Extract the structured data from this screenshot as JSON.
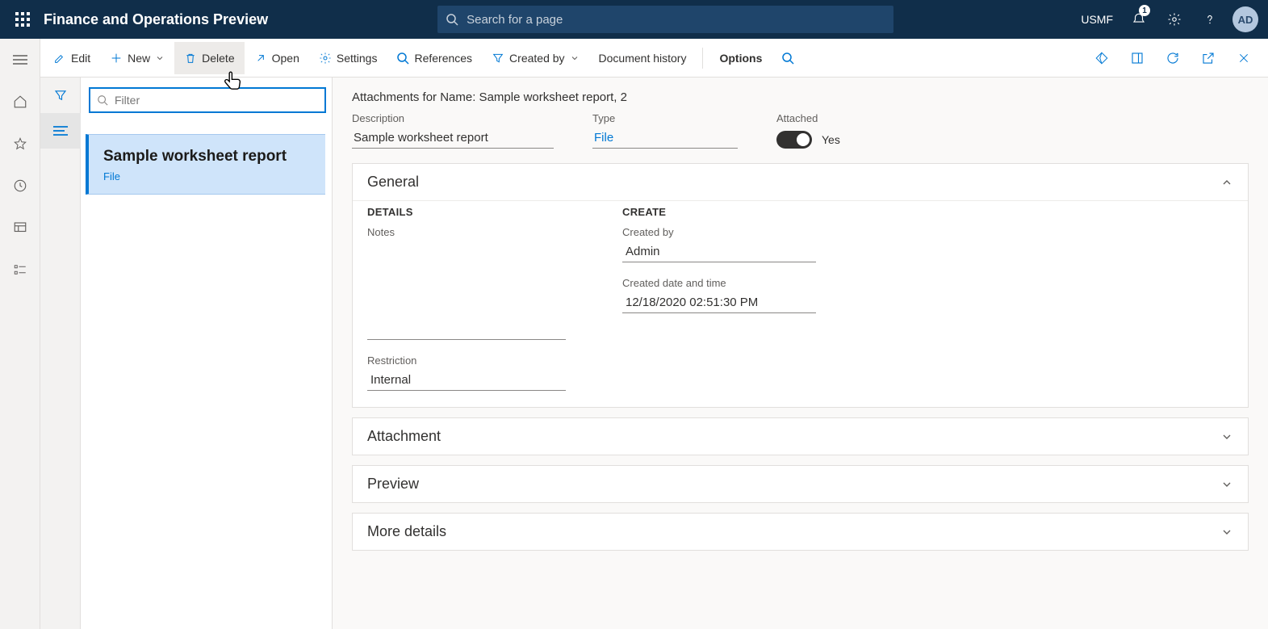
{
  "topnav": {
    "app_title": "Finance and Operations Preview",
    "search_placeholder": "Search for a page",
    "company": "USMF",
    "notification_count": "1",
    "avatar_initials": "AD"
  },
  "actionbar": {
    "edit": "Edit",
    "new": "New",
    "delete": "Delete",
    "open": "Open",
    "settings": "Settings",
    "references": "References",
    "created_by": "Created by",
    "document_history": "Document history",
    "options": "Options"
  },
  "list": {
    "filter_placeholder": "Filter",
    "items": [
      {
        "title": "Sample worksheet report",
        "sub": "File"
      }
    ]
  },
  "detail": {
    "header": "Attachments for Name: Sample worksheet report, 2",
    "fields": {
      "description_label": "Description",
      "description_value": "Sample worksheet report",
      "type_label": "Type",
      "type_value": "File",
      "attached_label": "Attached",
      "attached_value": "Yes"
    },
    "general": {
      "title": "General",
      "details_group": "DETAILS",
      "notes_label": "Notes",
      "restriction_label": "Restriction",
      "restriction_value": "Internal",
      "create_group": "CREATE",
      "created_by_label": "Created by",
      "created_by_value": "Admin",
      "created_dt_label": "Created date and time",
      "created_dt_value": "12/18/2020 02:51:30 PM"
    },
    "attachment_title": "Attachment",
    "preview_title": "Preview",
    "more_title": "More details"
  }
}
